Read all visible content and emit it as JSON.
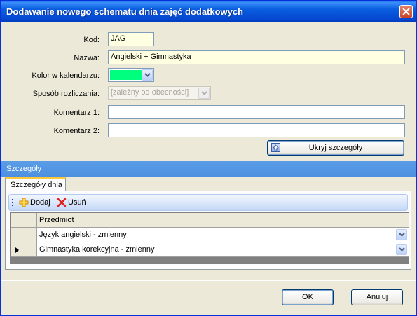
{
  "window": {
    "title": "Dodawanie nowego schematu dnia zajęć dodatkowych"
  },
  "form": {
    "code_label": "Kod:",
    "code_value": "JAG",
    "name_label": "Nazwa:",
    "name_value": "Angielski + Gimnastyka",
    "color_label": "Kolor w kalendarzu:",
    "color_value": "#00ff7f",
    "billing_label": "Sposób rozliczania:",
    "billing_value": "[zależny od obecności]",
    "comment1_label": "Komentarz 1:",
    "comment1_value": "",
    "comment2_label": "Komentarz 2:",
    "comment2_value": "",
    "hide_details_label": "Ukryj szczegóły"
  },
  "details": {
    "section_title": "Szczegóły",
    "tab_label": "Szczegóły dnia",
    "toolbar": {
      "add_label": "Dodaj",
      "remove_label": "Usuń"
    },
    "grid": {
      "column_header": "Przedmiot",
      "rows": [
        {
          "subject": "Język angielski - zmienny",
          "current": false
        },
        {
          "subject": "Gimnastyka korekcyjna - zmienny",
          "current": true
        }
      ]
    }
  },
  "footer": {
    "ok_label": "OK",
    "cancel_label": "Anuluj"
  }
}
